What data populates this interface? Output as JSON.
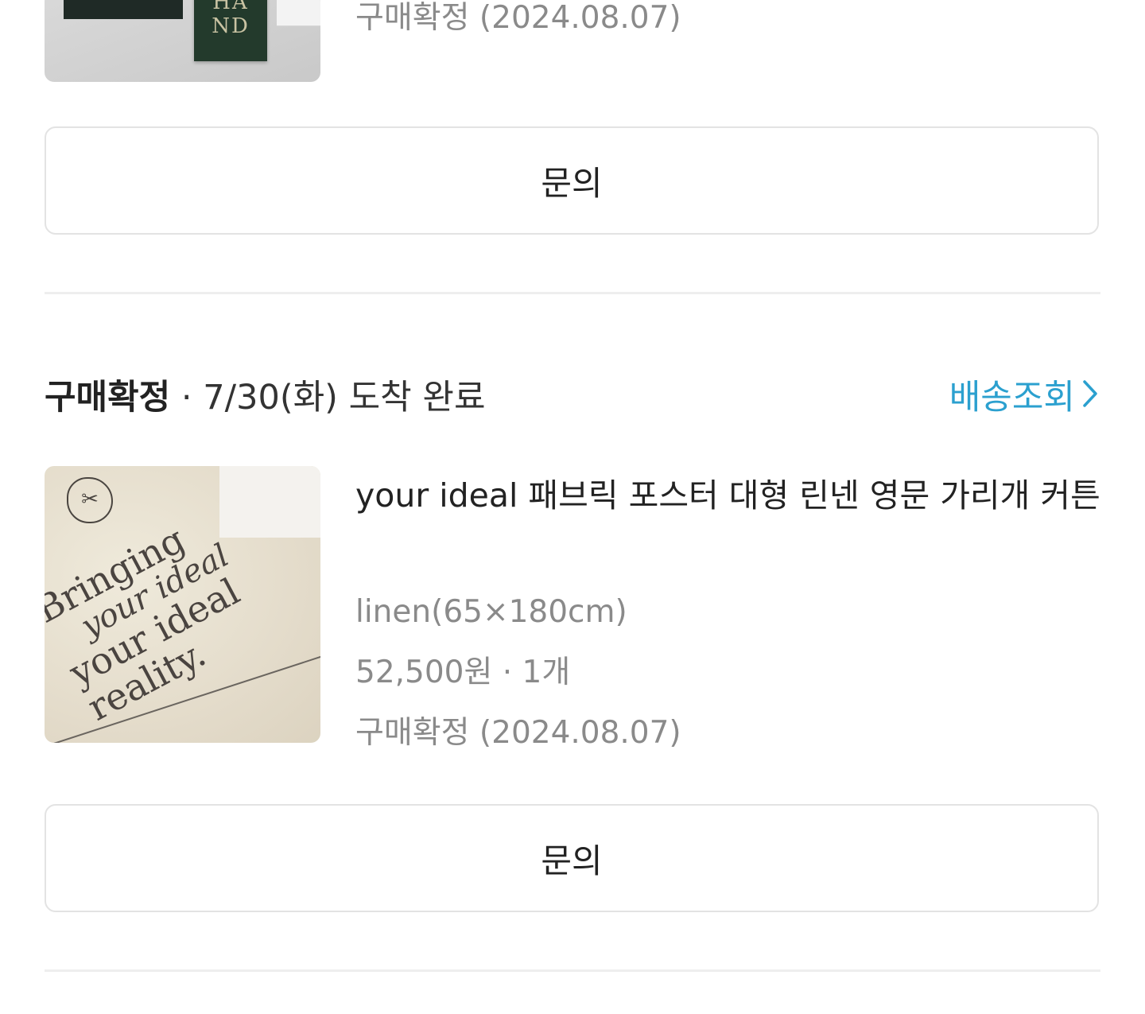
{
  "items": [
    {
      "status_text": "구매확정 (2024.08.07)",
      "thumbnail_mark": "HA\nND",
      "action": {
        "label": "문의"
      }
    },
    {
      "group_header": {
        "status": "구매확정",
        "separator": " · ",
        "arrival": "7/30(화) 도착 완료"
      },
      "track_link": {
        "label": "배송조회",
        "icon": "chevron-right-icon"
      },
      "title": "your ideal 패브릭 포스터 대형 린넨 영문 가리개 커튼",
      "option": "linen(65×180cm)",
      "price_qty": "52,500원 · 1개",
      "status_text": "구매확정 (2024.08.07)",
      "thumbnail_text": [
        "Bringing",
        "your ideal",
        "your ideal",
        "reality."
      ],
      "action": {
        "label": "문의"
      }
    }
  ],
  "colors": {
    "link": "#2ba0cf",
    "muted_text": "#8a8a8a",
    "border": "#e3e3e3",
    "divider": "#eeeeee"
  }
}
